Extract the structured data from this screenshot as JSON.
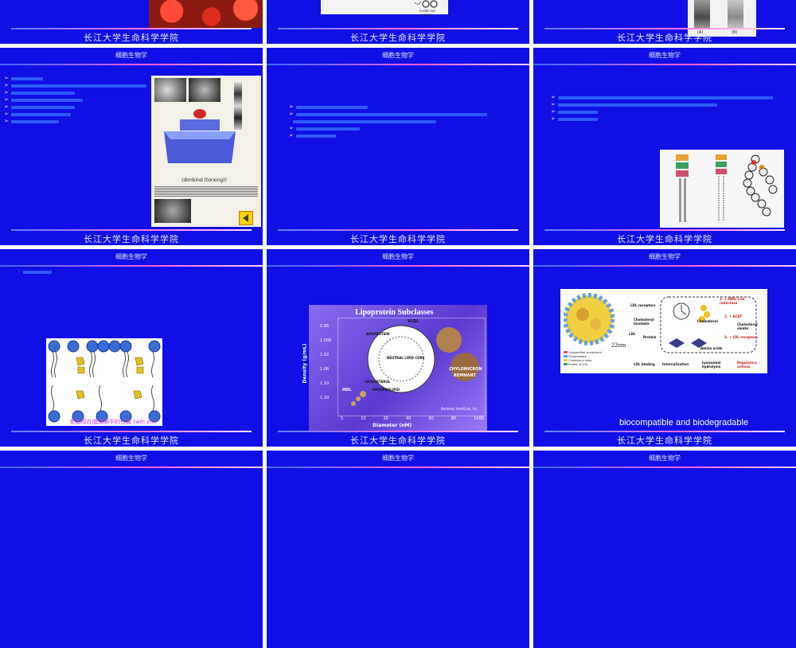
{
  "header": "细胞生物学",
  "footer": "长江大学生命科学学院",
  "slides": {
    "s1": {
      "footer": "长江大学生命科学学院"
    },
    "s2": {
      "figure_label": "inside-out vesicles",
      "footer": "长江大学生命科学学院"
    },
    "s3": {
      "label_a": "(A)",
      "label_b": "(B)",
      "footer": "长江大学生命科学学院"
    },
    "s4": {
      "header": "细胞生物学",
      "fig_caption": "(dimbind (torxing))",
      "footer": "长江大学生命科学学院"
    },
    "s5": {
      "header": "细胞生物学",
      "footer": "长江大学生命科学学院"
    },
    "s6": {
      "header": "细胞生物学",
      "footer": "长江大学生命科学学院"
    },
    "s7": {
      "header": "细胞生物学",
      "fig_caption": "胆固醇在脂双层中的位置 (wèi zhì)",
      "footer": "长江大学生命科学学院"
    },
    "s8": {
      "header": "细胞生物学",
      "title": "Lipoprotein Subclasses",
      "ylabel": "Density (g/mL)",
      "xlabel": "Diameter (nM)",
      "yticks": [
        "0.95",
        "1.006",
        "1.02",
        "1.06",
        "1.10",
        "1.20"
      ],
      "xticks": [
        "5",
        "10",
        "20",
        "40",
        "60",
        "80",
        "1000"
      ],
      "labels": {
        "vldl": "VLDL",
        "hdl": "HDL",
        "chylo": "CHYLOMICRON",
        "remnant": "REMNANT",
        "apo": "APOPROTEIN",
        "core": "NEUTRAL LIPID CORE",
        "chol": "CHOLESTEROL",
        "phos": "PHOSPHOLIPID"
      },
      "credit": "Berkeley HeartLab, Inc.",
      "footer": "长江大学生命科学学院"
    },
    "s9": {
      "header": "细胞生物学",
      "size": "22nm",
      "labels": {
        "ldl_receptors": "LDL receptors",
        "chol_linoleate": "Cholesteryl linoleate",
        "ldl": "LDL",
        "protein": "Protein",
        "step1": "1. ↓ HMG CoA reductase",
        "step2": "2. ↑ ACAT",
        "step3": "3. ↓ LDL receptors",
        "cholesterol": "Cholesterol",
        "chol_oleate": "Cholesteryl oleate",
        "amino": "Amino acids",
        "binding": "LDL binding",
        "internal": "Internalization",
        "lyso": "Lysosomal hydrolysis",
        "reg": "Regulatory actions",
        "leg1": "Unesterified cholesterol",
        "leg2": "Phospholipid",
        "leg3": "Cholesteryl ester",
        "leg4": "Protein B-100"
      },
      "caption": "biocompatible and biodegradable",
      "footer": "长江大学生命科学学院"
    },
    "s10": {
      "header": "细胞生物学"
    },
    "s11": {
      "header": "细胞生物学"
    },
    "s12": {
      "header": "细胞生物学"
    }
  },
  "colors": {
    "slide_bg": "#0f0fe6",
    "page_bg": "#ffffff",
    "footer_text": "#e9e9ff",
    "bullet_text": "#1a40ff"
  }
}
